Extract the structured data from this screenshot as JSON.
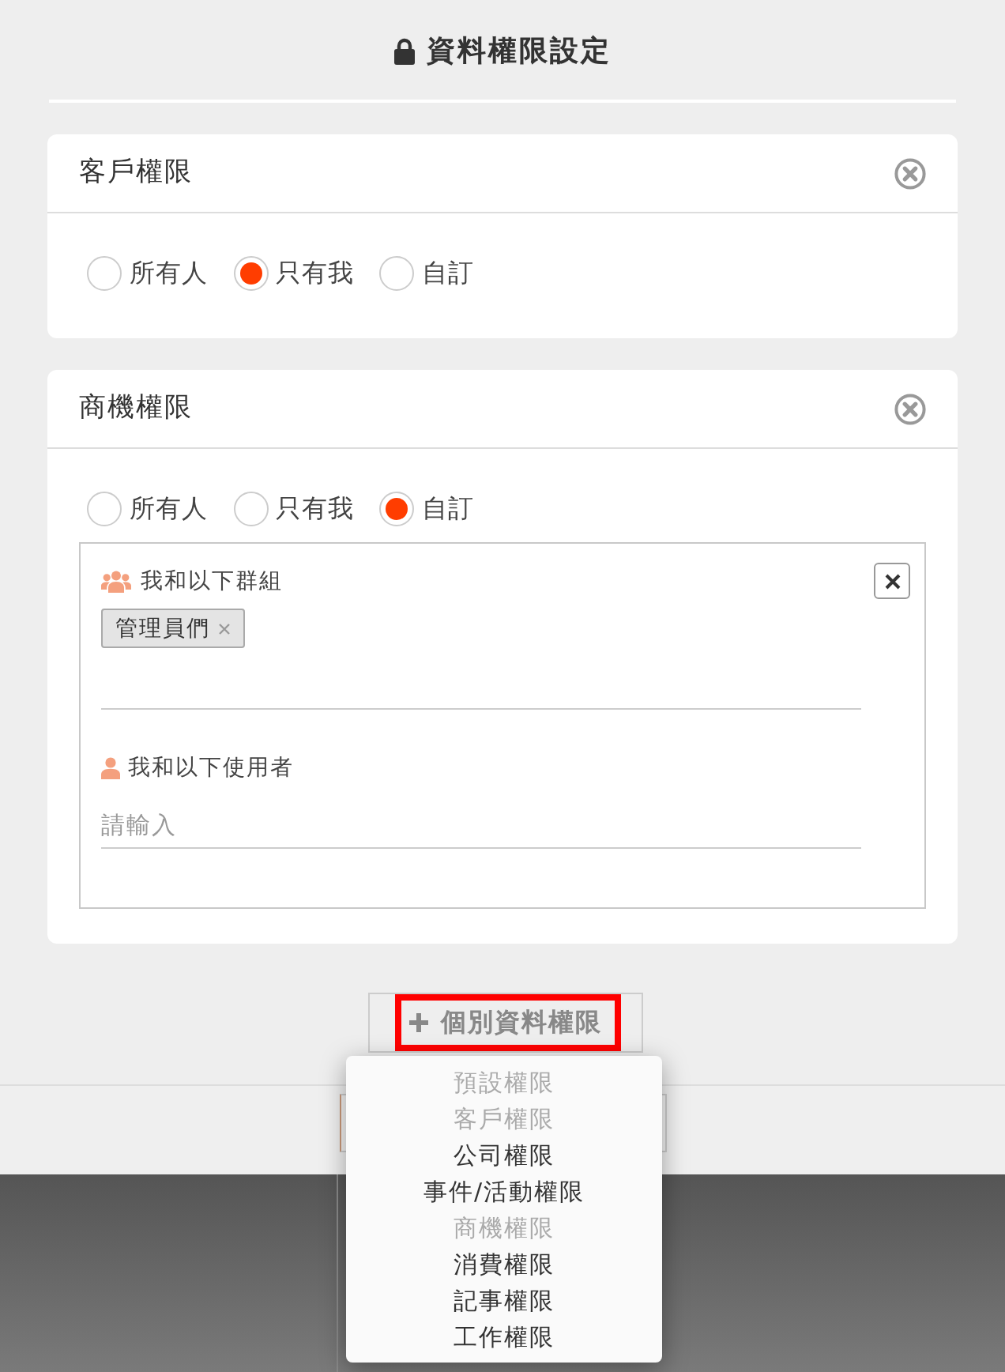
{
  "dialog": {
    "title": "資料權限設定"
  },
  "sections": [
    {
      "title": "客戶權限",
      "options": [
        {
          "label": "所有人",
          "selected": false
        },
        {
          "label": "只有我",
          "selected": true
        },
        {
          "label": "自訂",
          "selected": false
        }
      ]
    },
    {
      "title": "商機權限",
      "options": [
        {
          "label": "所有人",
          "selected": false
        },
        {
          "label": "只有我",
          "selected": false
        },
        {
          "label": "自訂",
          "selected": true
        }
      ],
      "custom": {
        "group_label": "我和以下群組",
        "tags": [
          "管理員們"
        ],
        "user_label": "我和以下使用者",
        "user_input": {
          "placeholder": "請輸入"
        }
      }
    }
  ],
  "add_button": {
    "label": "個別資料權限",
    "highlighted": true
  },
  "dropdown": {
    "items": [
      {
        "label": "預設權限",
        "disabled": true
      },
      {
        "label": "客戶權限",
        "disabled": true
      },
      {
        "label": "公司權限",
        "disabled": false
      },
      {
        "label": "事件/活動權限",
        "disabled": false
      },
      {
        "label": "商機權限",
        "disabled": true
      },
      {
        "label": "消費權限",
        "disabled": false
      },
      {
        "label": "記事權限",
        "disabled": false
      },
      {
        "label": "工作權限",
        "disabled": false
      }
    ]
  }
}
